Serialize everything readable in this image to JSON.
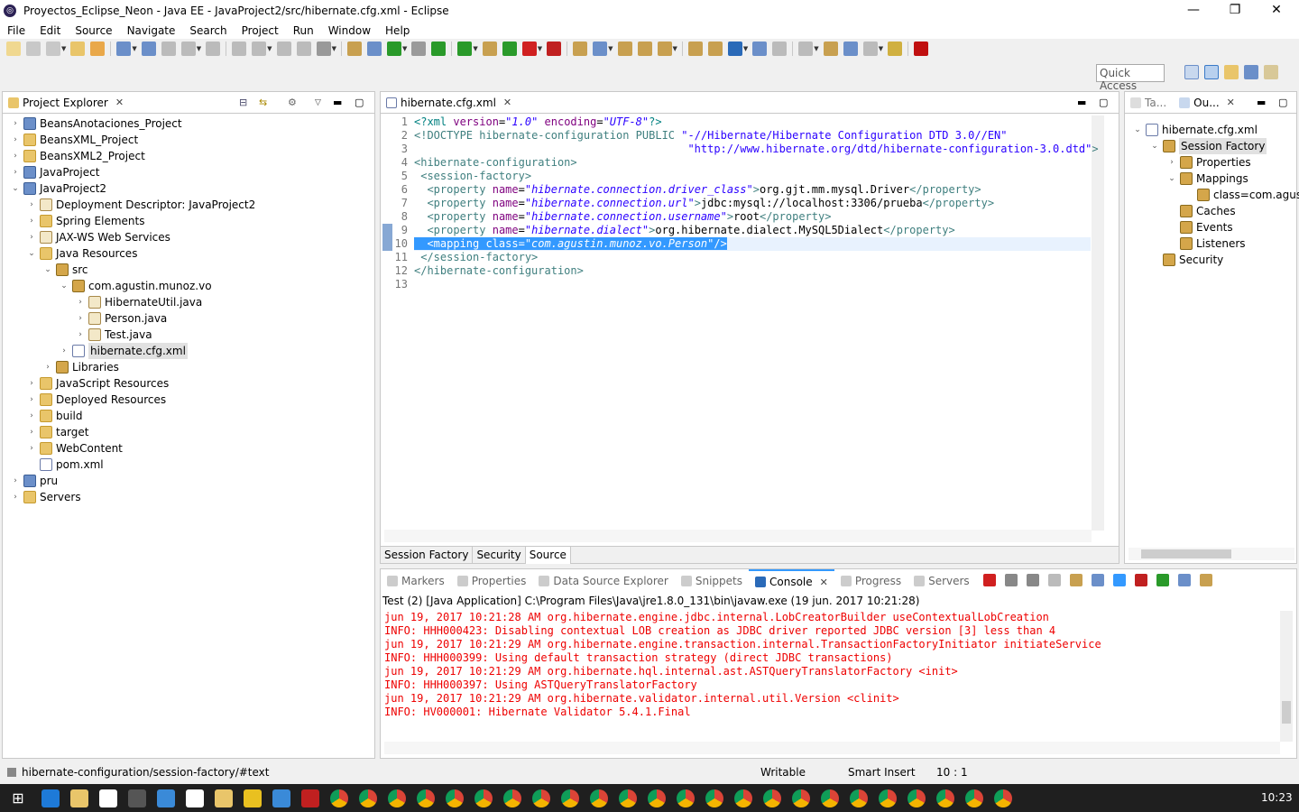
{
  "window": {
    "title": "Proyectos_Eclipse_Neon - Java EE - JavaProject2/src/hibernate.cfg.xml - Eclipse"
  },
  "menu": [
    "File",
    "Edit",
    "Source",
    "Navigate",
    "Search",
    "Project",
    "Run",
    "Window",
    "Help"
  ],
  "quick_access": {
    "placeholder": "Quick Access"
  },
  "explorer": {
    "title": "Project Explorer",
    "items": [
      {
        "label": "BeansAnotaciones_Project",
        "depth": 0,
        "arrow": "›",
        "icon": "proj"
      },
      {
        "label": "BeansXML_Project",
        "depth": 0,
        "arrow": "›",
        "icon": "folder"
      },
      {
        "label": "BeansXML2_Project",
        "depth": 0,
        "arrow": "›",
        "icon": "folder"
      },
      {
        "label": "JavaProject",
        "depth": 0,
        "arrow": "›",
        "icon": "proj"
      },
      {
        "label": "JavaProject2",
        "depth": 0,
        "arrow": "⌄",
        "icon": "proj"
      },
      {
        "label": "Deployment Descriptor: JavaProject2",
        "depth": 1,
        "arrow": "›",
        "icon": "jfile"
      },
      {
        "label": "Spring Elements",
        "depth": 1,
        "arrow": "›",
        "icon": "folder"
      },
      {
        "label": "JAX-WS Web Services",
        "depth": 1,
        "arrow": "›",
        "icon": "jfile"
      },
      {
        "label": "Java Resources",
        "depth": 1,
        "arrow": "⌄",
        "icon": "folder"
      },
      {
        "label": "src",
        "depth": 2,
        "arrow": "⌄",
        "icon": "pkg"
      },
      {
        "label": "com.agustin.munoz.vo",
        "depth": 3,
        "arrow": "⌄",
        "icon": "pkg"
      },
      {
        "label": "HibernateUtil.java",
        "depth": 4,
        "arrow": "›",
        "icon": "jfile"
      },
      {
        "label": "Person.java",
        "depth": 4,
        "arrow": "›",
        "icon": "jfile"
      },
      {
        "label": "Test.java",
        "depth": 4,
        "arrow": "›",
        "icon": "jfile"
      },
      {
        "label": "hibernate.cfg.xml",
        "depth": 3,
        "arrow": "›",
        "icon": "xmlf",
        "selected": true
      },
      {
        "label": "Libraries",
        "depth": 2,
        "arrow": "›",
        "icon": "pkg"
      },
      {
        "label": "JavaScript Resources",
        "depth": 1,
        "arrow": "›",
        "icon": "folder"
      },
      {
        "label": "Deployed Resources",
        "depth": 1,
        "arrow": "›",
        "icon": "folder"
      },
      {
        "label": "build",
        "depth": 1,
        "arrow": "›",
        "icon": "folder"
      },
      {
        "label": "target",
        "depth": 1,
        "arrow": "›",
        "icon": "folder"
      },
      {
        "label": "WebContent",
        "depth": 1,
        "arrow": "›",
        "icon": "folder"
      },
      {
        "label": "pom.xml",
        "depth": 1,
        "arrow": "",
        "icon": "xmlf"
      },
      {
        "label": "pru",
        "depth": 0,
        "arrow": "›",
        "icon": "proj"
      },
      {
        "label": "Servers",
        "depth": 0,
        "arrow": "›",
        "icon": "folder"
      }
    ]
  },
  "editor": {
    "tab": "hibernate.cfg.xml",
    "lines": [
      {
        "n": "1",
        "html": "<span class='pi'>&lt;?xml</span> <span class='an'>version</span>=<span class='av'>\"1.0\"</span> <span class='an'>encoding</span>=<span class='av'>\"UTF-8\"</span><span class='pi'>?&gt;</span>"
      },
      {
        "n": "2",
        "html": "<span class='tag'>&lt;!DOCTYPE</span> <span class='tag'>hibernate-configuration</span> <span class='tag'>PUBLIC</span> <span class='dt'>\"-//Hibernate/Hibernate Configuration DTD 3.0//EN\"</span>"
      },
      {
        "n": "3",
        "html": "                                          <span class='dt'>\"http://www.hibernate.org/dtd/hibernate-configuration-3.0.dtd\"</span><span class='tag'>&gt;</span>"
      },
      {
        "n": "4",
        "html": "<span class='tag'>&lt;hibernate-configuration&gt;</span>"
      },
      {
        "n": "5",
        "html": " <span class='tag'>&lt;session-factory&gt;</span>"
      },
      {
        "n": "6",
        "html": "  <span class='tag'>&lt;property</span> <span class='an'>name</span>=<span class='av'>\"hibernate.connection.driver_class\"</span><span class='tag'>&gt;</span>org.gjt.mm.mysql.Driver<span class='tag'>&lt;/property&gt;</span>"
      },
      {
        "n": "7",
        "html": "  <span class='tag'>&lt;property</span> <span class='an'>name</span>=<span class='av'>\"hibernate.connection.url\"</span><span class='tag'>&gt;</span>jdbc:mysql://localhost:3306/prueba<span class='tag'>&lt;/property&gt;</span>"
      },
      {
        "n": "8",
        "html": "  <span class='tag'>&lt;property</span> <span class='an'>name</span>=<span class='av'>\"hibernate.connection.username\"</span><span class='tag'>&gt;</span>root<span class='tag'>&lt;/property&gt;</span>"
      },
      {
        "n": "9",
        "html": "  <span class='tag'>&lt;property</span> <span class='an'>name</span>=<span class='av'>\"hibernate.dialect\"</span><span class='tag'>&gt;</span>org.hibernate.dialect.MySQL5Dialect<span class='tag'>&lt;/property&gt;</span>"
      },
      {
        "n": "10",
        "html": "<span class='hl'>  &lt;mapping class=\"<i>com.agustin.munoz.vo.Person</i>\"/&gt;</span>"
      },
      {
        "n": "11",
        "html": " <span class='tag'>&lt;/session-factory&gt;</span>"
      },
      {
        "n": "12",
        "html": "<span class='tag'>&lt;/hibernate-configuration&gt;</span>"
      },
      {
        "n": "13",
        "html": ""
      }
    ],
    "bottom_tabs": [
      "Session Factory",
      "Security",
      "Source"
    ]
  },
  "outline": {
    "tabs": [
      "Ta...",
      "Ou..."
    ],
    "items": [
      {
        "label": "hibernate.cfg.xml",
        "depth": 0,
        "arrow": "⌄"
      },
      {
        "label": "Session Factory",
        "depth": 1,
        "arrow": "⌄",
        "selected": true
      },
      {
        "label": "Properties",
        "depth": 2,
        "arrow": "›"
      },
      {
        "label": "Mappings",
        "depth": 2,
        "arrow": "⌄"
      },
      {
        "label": "class=com.agus",
        "depth": 3,
        "arrow": ""
      },
      {
        "label": "Caches",
        "depth": 2,
        "arrow": ""
      },
      {
        "label": "Events",
        "depth": 2,
        "arrow": ""
      },
      {
        "label": "Listeners",
        "depth": 2,
        "arrow": ""
      },
      {
        "label": "Security",
        "depth": 1,
        "arrow": ""
      }
    ]
  },
  "console": {
    "tabs": [
      "Markers",
      "Properties",
      "Data Source Explorer",
      "Snippets",
      "Console",
      "Progress",
      "Servers"
    ],
    "active_tab": "Console",
    "header": "Test (2) [Java Application] C:\\Program Files\\Java\\jre1.8.0_131\\bin\\javaw.exe (19 jun. 2017 10:21:28)",
    "lines": [
      "jun 19, 2017 10:21:28 AM org.hibernate.engine.jdbc.internal.LobCreatorBuilder useContextualLobCreation",
      "INFO: HHH000423: Disabling contextual LOB creation as JDBC driver reported JDBC version [3] less than 4",
      "jun 19, 2017 10:21:29 AM org.hibernate.engine.transaction.internal.TransactionFactoryInitiator initiateService",
      "INFO: HHH000399: Using default transaction strategy (direct JDBC transactions)",
      "jun 19, 2017 10:21:29 AM org.hibernate.hql.internal.ast.ASTQueryTranslatorFactory <init>",
      "INFO: HHH000397: Using ASTQueryTranslatorFactory",
      "jun 19, 2017 10:21:29 AM org.hibernate.validator.internal.util.Version <clinit>",
      "INFO: HV000001: Hibernate Validator 5.4.1.Final"
    ]
  },
  "status": {
    "path": "hibernate-configuration/session-factory/#text",
    "writable": "Writable",
    "insert": "Smart Insert",
    "position": "10 : 1"
  },
  "taskbar": {
    "clock": "10:23"
  },
  "colors": {
    "accent": "#3399ff",
    "console_text": "#e00000",
    "selection": "#e1e1e1"
  }
}
